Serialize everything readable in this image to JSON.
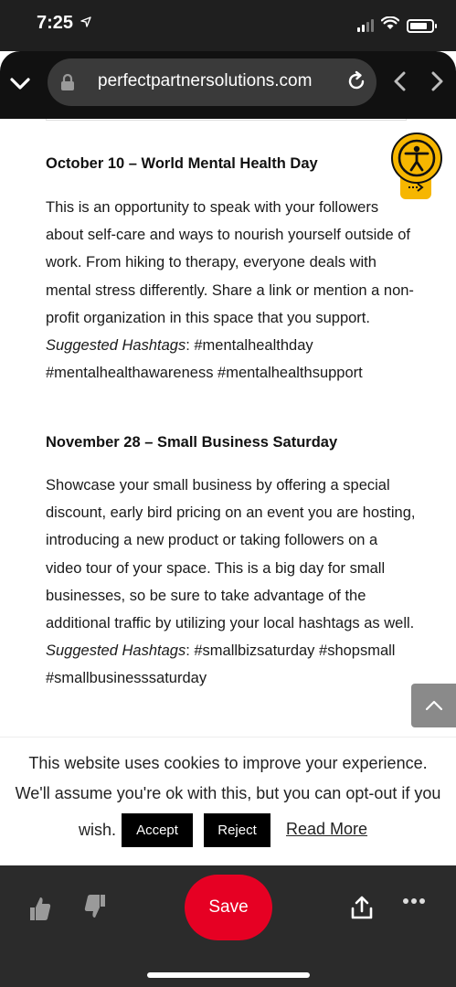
{
  "status_bar": {
    "time": "7:25"
  },
  "browser": {
    "url": "perfectpartnersolutions.com"
  },
  "article": {
    "section1": {
      "heading": "October 10 – World Mental Health Day",
      "body": "This is an opportunity to speak with your followers about self-care and ways to nourish yourself outside of work. From hiking to therapy, everyone deals with mental stress differently. Share a link or mention a non-profit organization in this space that you support.",
      "tags_label": "Suggested Hashtags",
      "tags": ": #mentalhealthday #mentalhealthawareness #mentalhealthsupport"
    },
    "section2": {
      "heading": "November 28 – Small Business Saturday",
      "body": "Showcase your small business by offering a special discount, early bird pricing on an event you are hosting, introducing a new product or taking followers on a video tour of your space. This is a big day for small businesses, so be sure to take advantage of the additional traffic by utilizing your local hashtags as well.",
      "tags_label": "Suggested Hashtags",
      "tags": ": #smallbizsaturday #shopsmall #smallbusinesssaturday"
    }
  },
  "cookie_banner": {
    "line1": "This website uses cookies to improve your experience.",
    "line2": "We'll assume you're ok with this, but you can opt-out if you",
    "line3": "wish.",
    "accept": "Accept",
    "reject": "Reject",
    "read_more": "Read More"
  },
  "toolbar": {
    "save": "Save"
  },
  "icons": {
    "collapse": "chevron-down-icon",
    "lock": "lock-icon",
    "reload": "reload-icon",
    "back": "chevron-left-icon",
    "forward": "chevron-right-icon",
    "accessibility": "accessibility-icon",
    "scroll_top": "chevron-up-icon",
    "like": "thumbs-up-icon",
    "dislike": "thumbs-down-icon",
    "share": "share-icon",
    "more": "more-icon"
  },
  "colors": {
    "save": "#e60023",
    "accessibility": "#f6b600",
    "toolbar": "#2b2b2b"
  }
}
